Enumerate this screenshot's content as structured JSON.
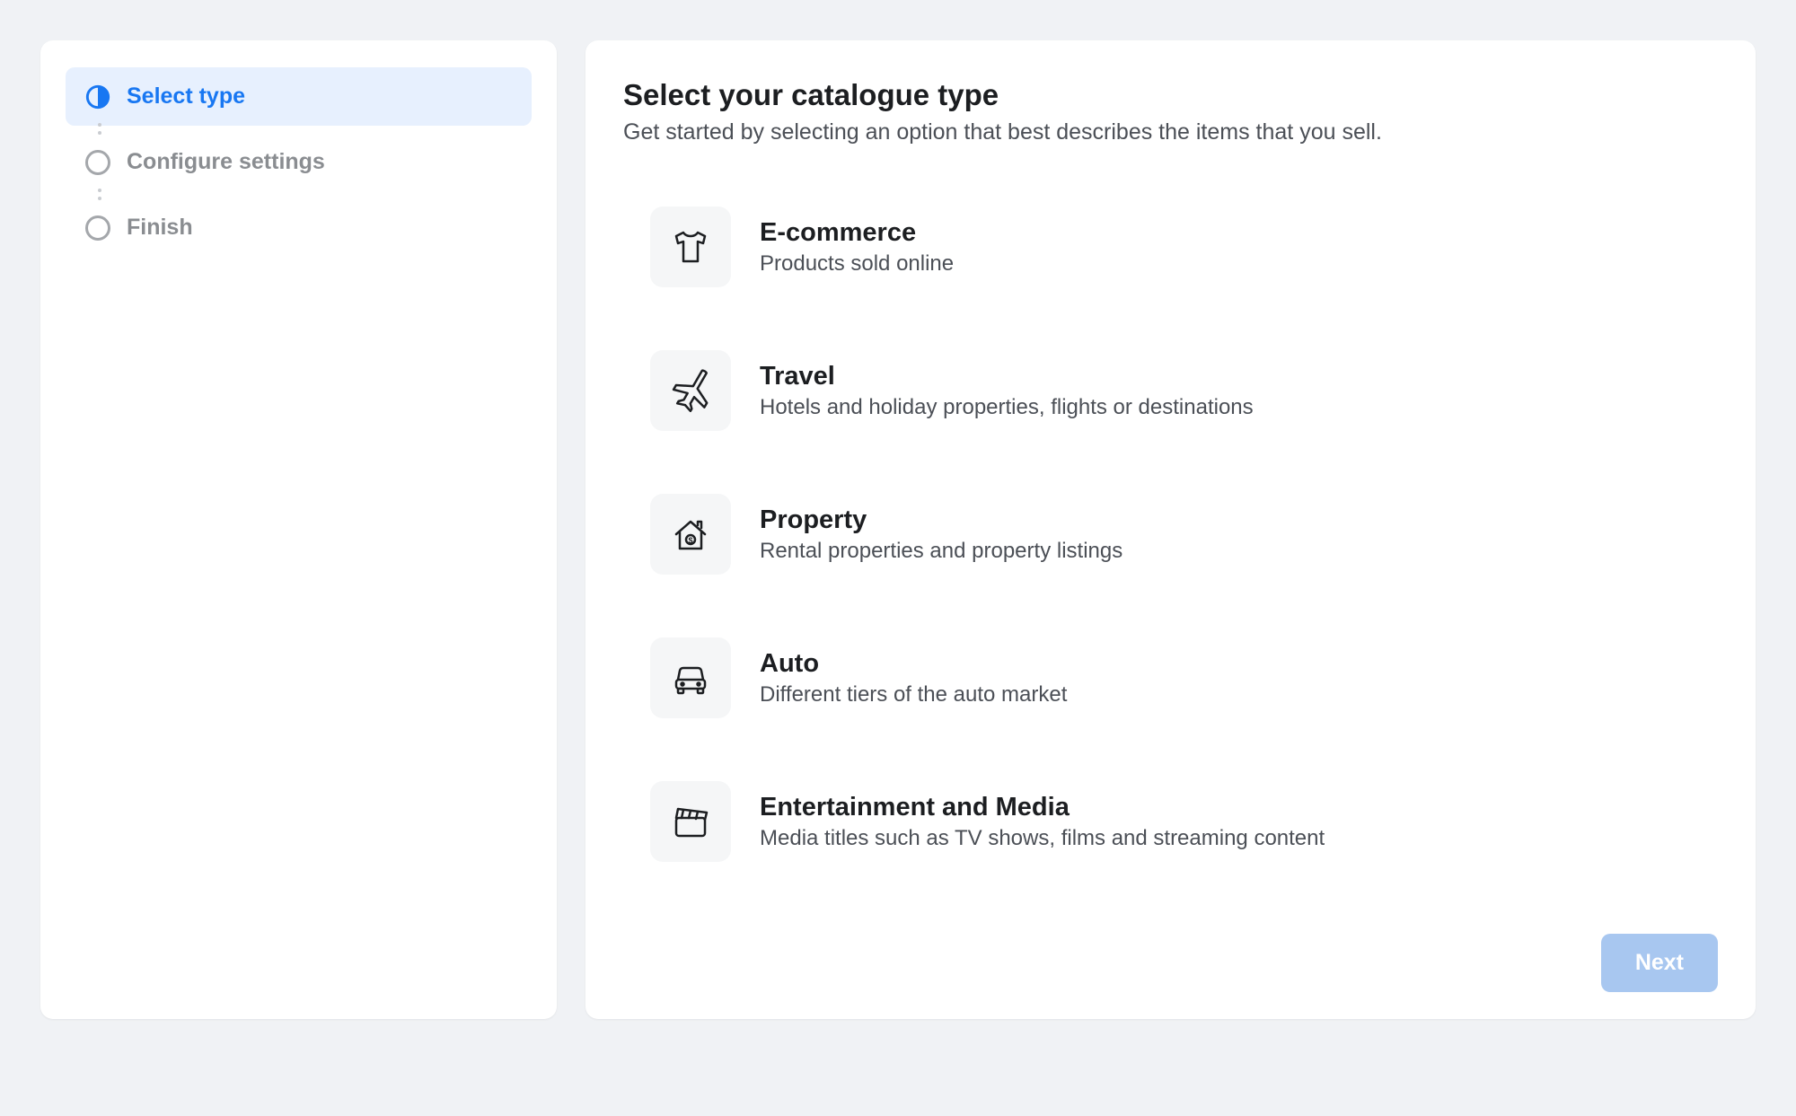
{
  "sidebar": {
    "steps": [
      {
        "label": "Select type",
        "state": "active"
      },
      {
        "label": "Configure settings",
        "state": "pending"
      },
      {
        "label": "Finish",
        "state": "pending"
      }
    ]
  },
  "main": {
    "title": "Select your catalogue type",
    "subtitle": "Get started by selecting an option that best describes the items that you sell.",
    "options": [
      {
        "icon": "shirt-icon",
        "title": "E-commerce",
        "description": "Products sold online"
      },
      {
        "icon": "plane-icon",
        "title": "Travel",
        "description": "Hotels and holiday properties, flights or destinations"
      },
      {
        "icon": "house-icon",
        "title": "Property",
        "description": "Rental properties and property listings"
      },
      {
        "icon": "car-icon",
        "title": "Auto",
        "description": "Different tiers of the auto market"
      },
      {
        "icon": "clapper-icon",
        "title": "Entertainment and Media",
        "description": "Media titles such as TV shows, films and streaming content"
      }
    ],
    "next_button": "Next"
  },
  "colors": {
    "accent": "#1877f2",
    "background": "#f0f2f5",
    "active_bg": "#e7f0fe"
  }
}
